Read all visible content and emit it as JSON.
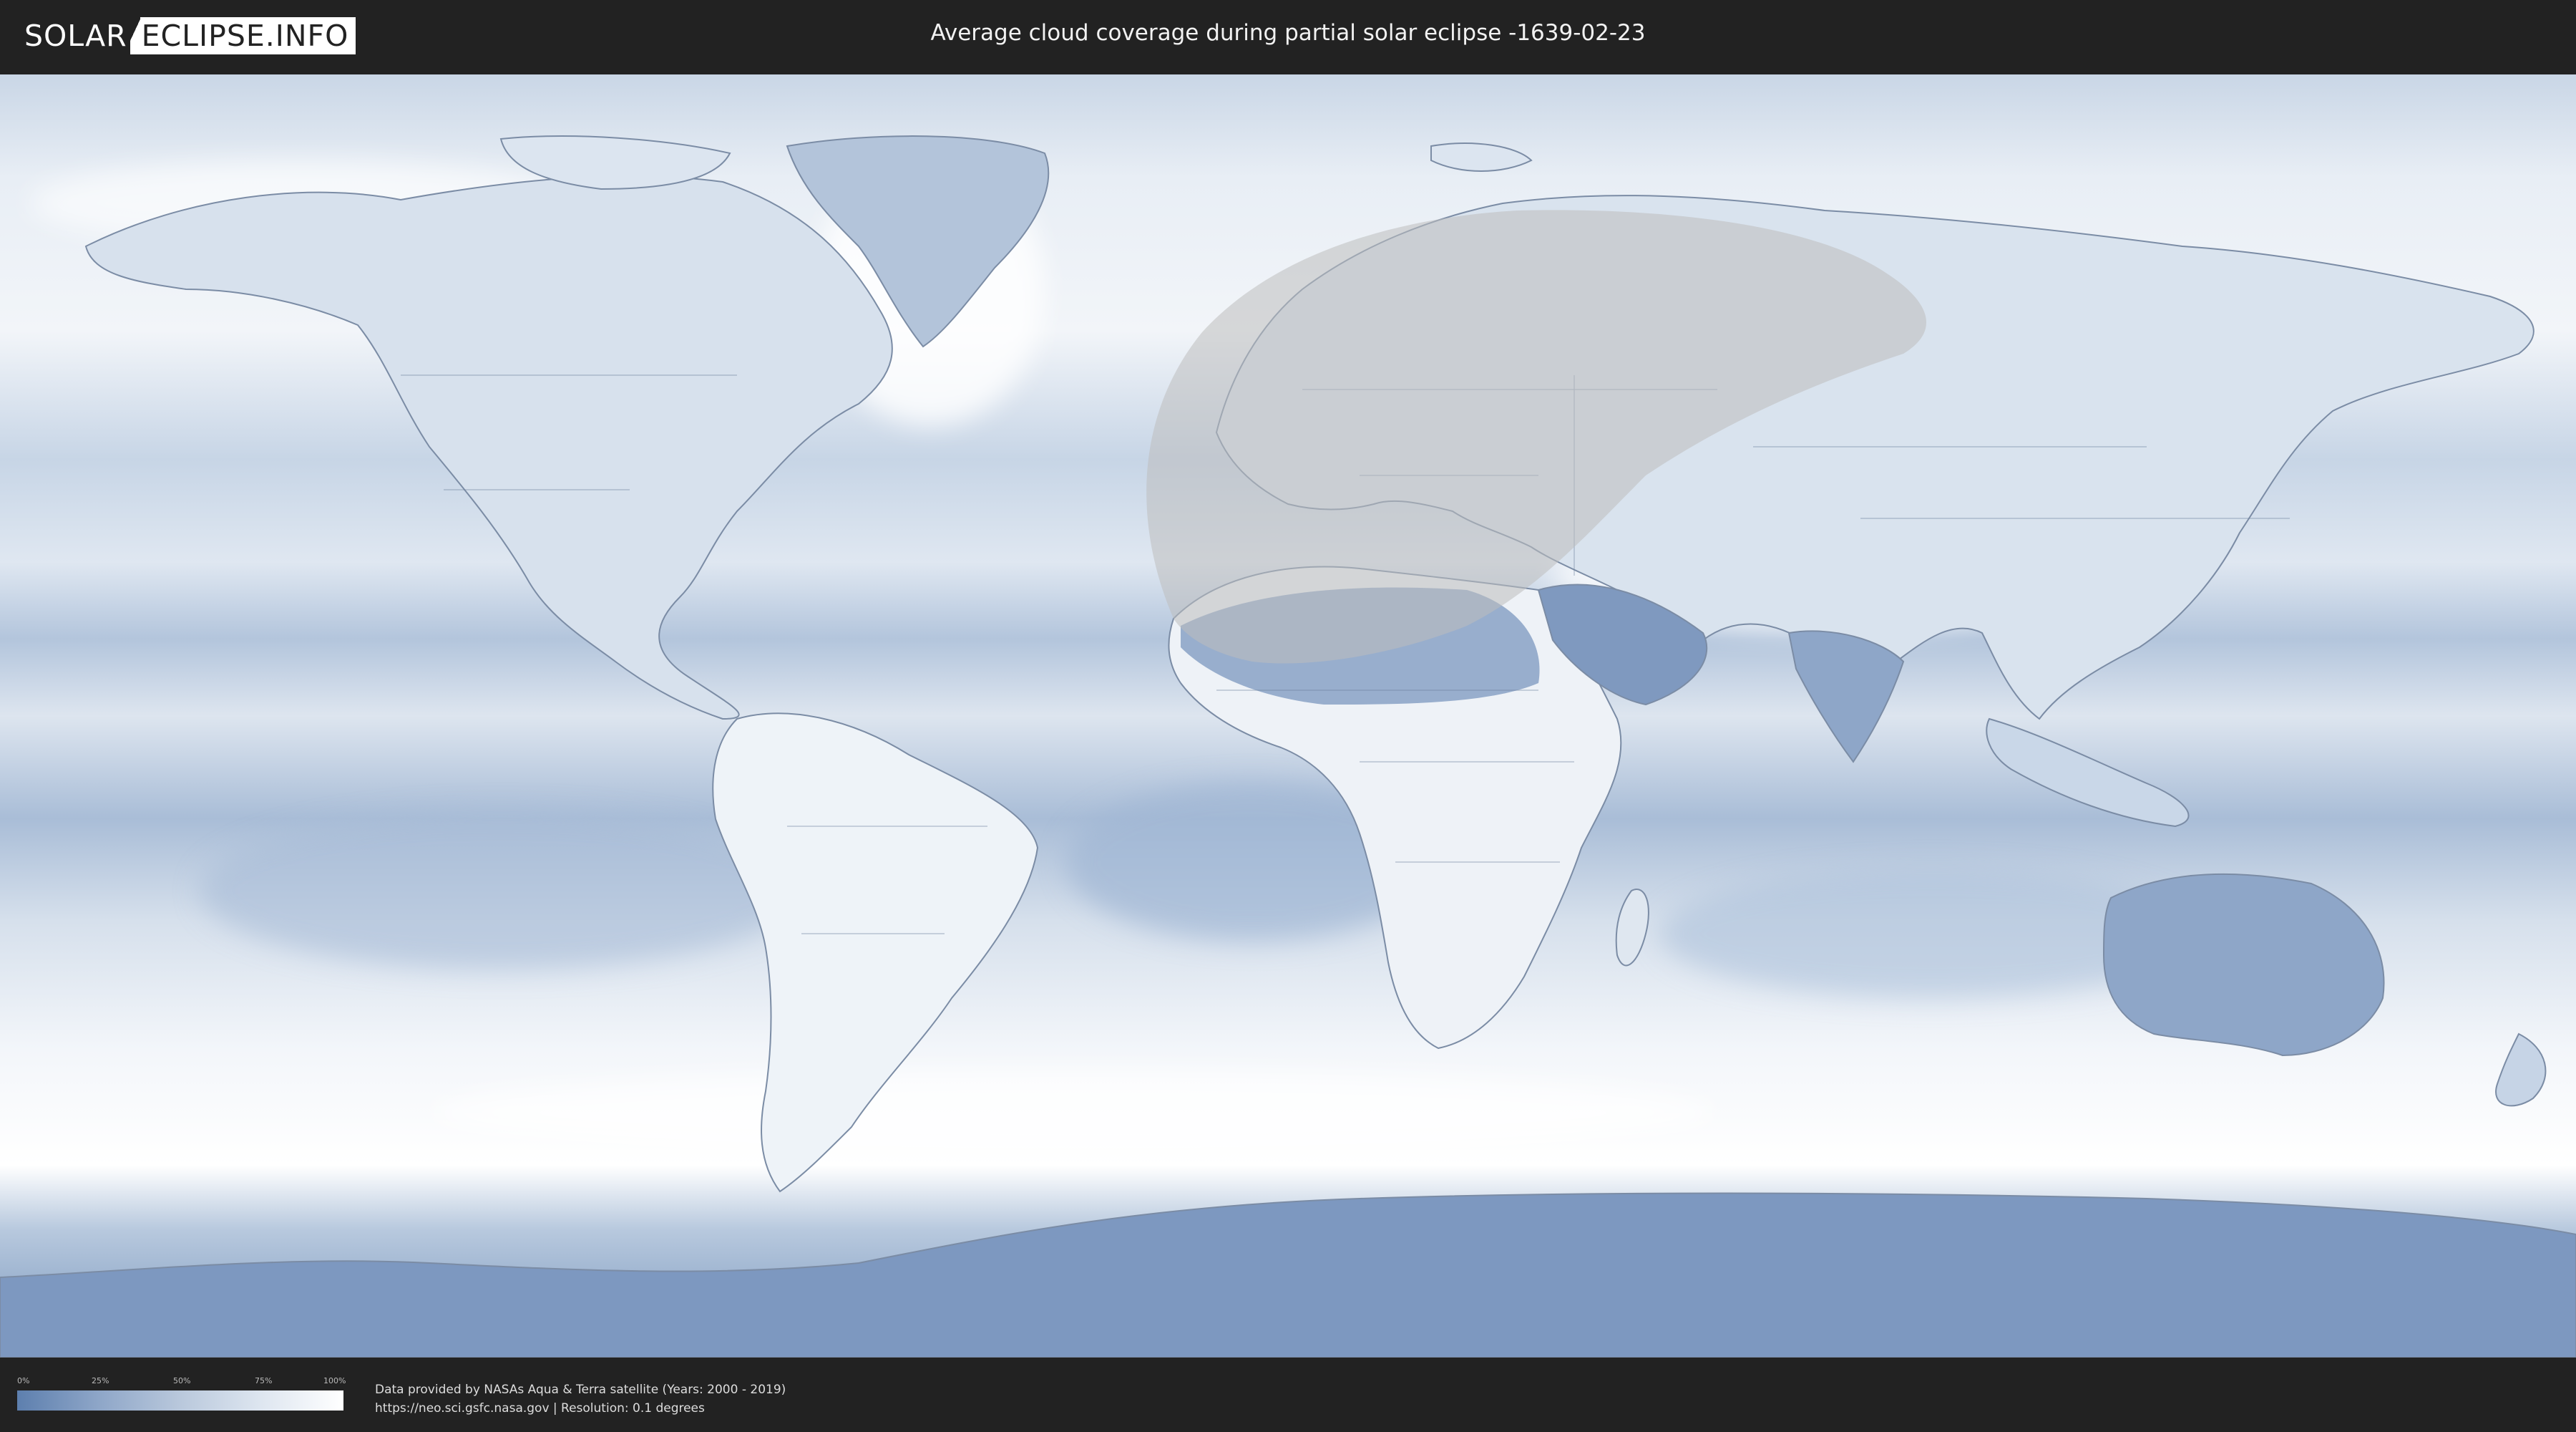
{
  "header": {
    "logo_left": "SOLAR",
    "logo_right": "ECLIPSE.INFO",
    "title": "Average cloud coverage during partial solar eclipse -1639-02-23"
  },
  "map": {
    "projection": "equirectangular",
    "cloud_color_low": "#5d7fae",
    "cloud_color_high": "#ffffff",
    "eclipse_shade_color": "#bdbdbd"
  },
  "legend": {
    "ticks": [
      "0%",
      "25%",
      "50%",
      "75%",
      "100%"
    ]
  },
  "footer": {
    "credit_line": "Data provided by NASAs Aqua & Terra satellite (Years: 2000 - 2019)",
    "source_line": "https://neo.sci.gsfc.nasa.gov | Resolution: 0.1 degrees"
  }
}
